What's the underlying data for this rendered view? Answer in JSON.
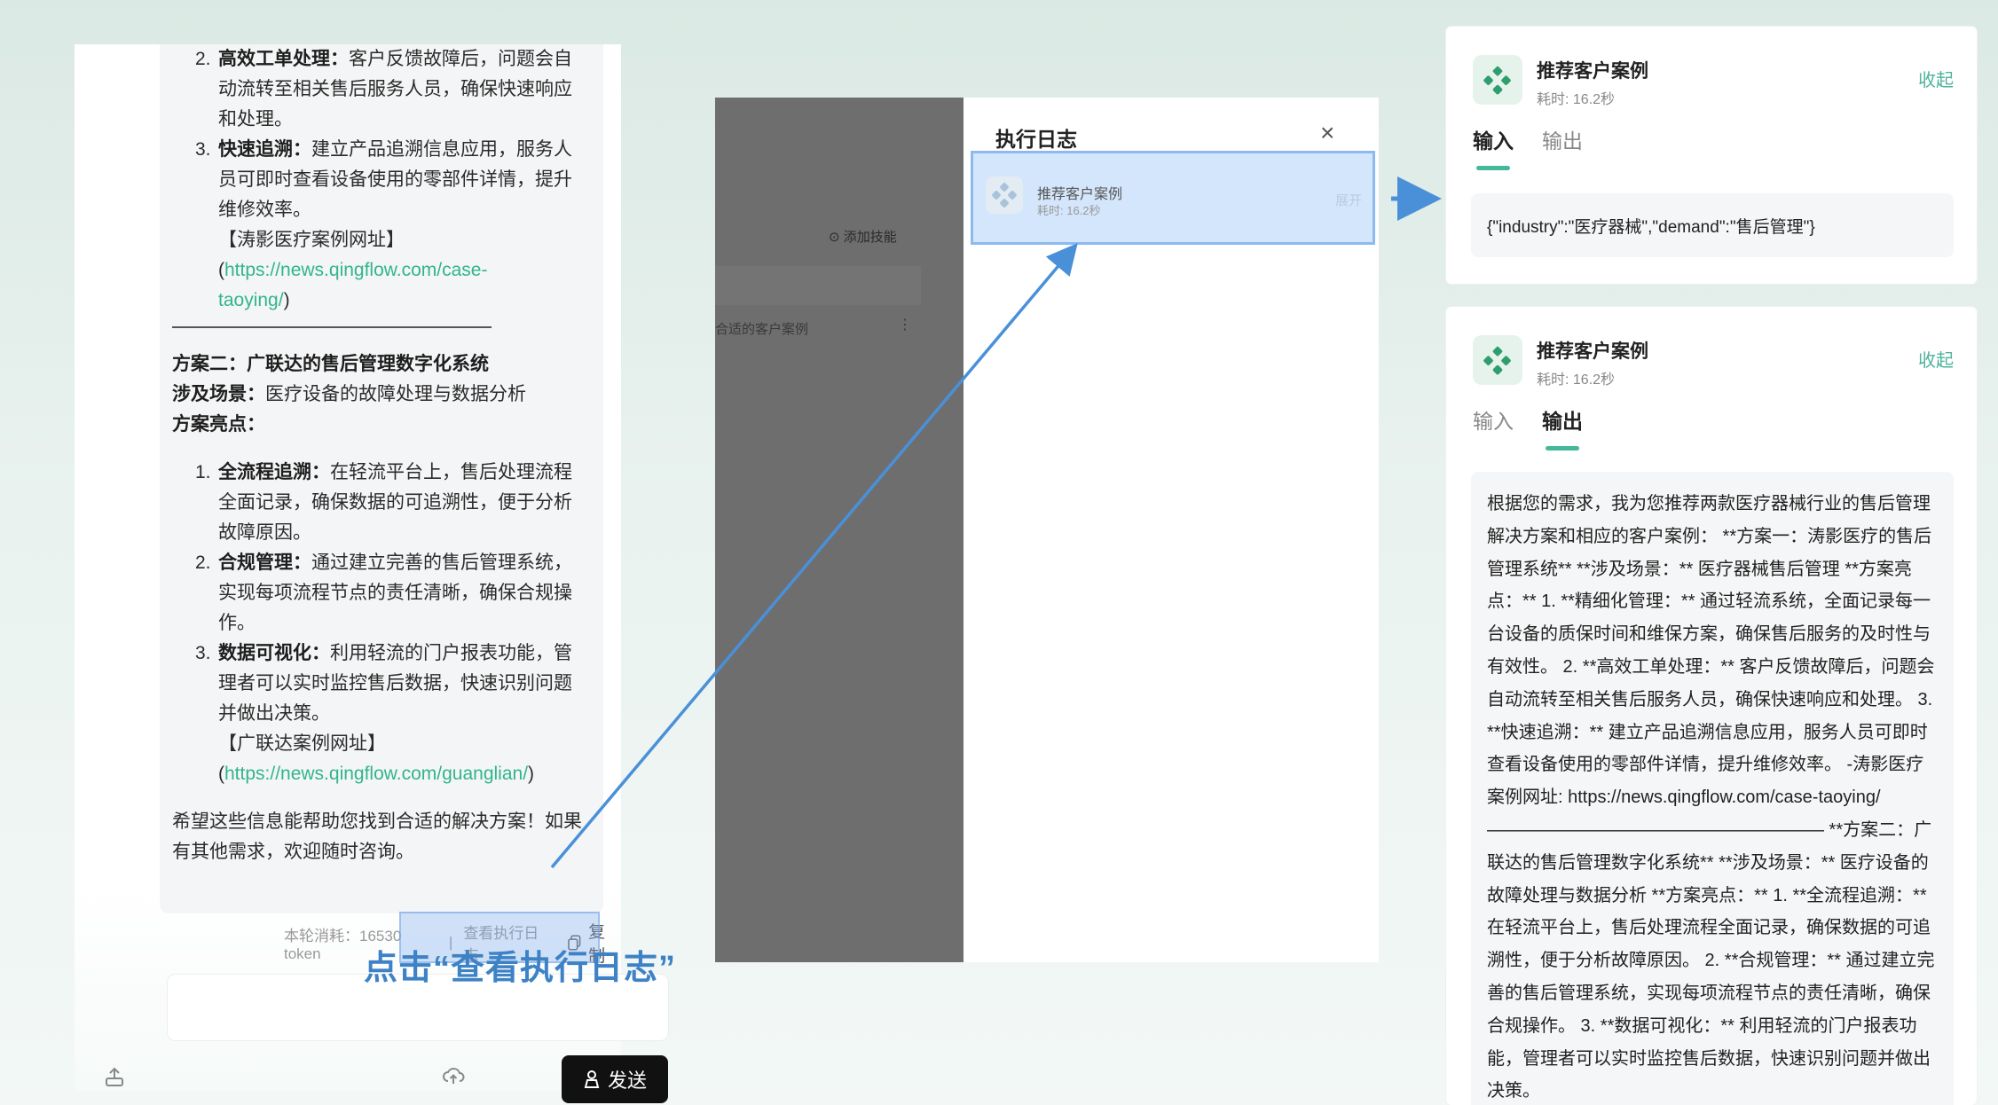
{
  "chat": {
    "item2_title": "高效工单处理：",
    "item2_text": "客户反馈故障后，问题会自动流转至相关售后服务人员，确保快速响应和处理。",
    "item3_title": "快速追溯：",
    "item3_text": "建立产品追溯信息应用，服务人员可即时查看设备使用的零部件详情，提升维修效率。",
    "case1_label": "【涛影医疗案例网址】",
    "case1_url_l1": "https://news.qingflow.com/case-",
    "case1_url_l2": "taoying/",
    "paren_open": "(",
    "paren_close": ")",
    "plan2_title": "方案二：广联达的售后管理数字化系统",
    "scene_label": "涉及场景：",
    "scene_text": "医疗设备的故障处理与数据分析",
    "highlights_label": "方案亮点：",
    "p1_title": "全流程追溯：",
    "p1_text": "在轻流平台上，售后处理流程全面记录，确保数据的可追溯性，便于分析故障原因。",
    "p2_title": "合规管理：",
    "p2_text": "通过建立完善的售后管理系统，实现每项流程节点的责任清晰，确保合规操作。",
    "p3_title": "数据可视化：",
    "p3_text": "利用轻流的门户报表功能，管理者可以实时监控售后数据，快速识别问题并做出决策。",
    "case2_label": "【广联达案例网址】",
    "case2_url": "https://news.qingflow.com/guanglian/",
    "closing": "希望这些信息能帮助您找到合适的解决方案！如果有其他需求，欢迎随时咨询。",
    "footer_tokens": "本轮消耗：16530 token",
    "footer_divider": "|",
    "footer_view_log": "查看执行日志",
    "footer_copy": "复制",
    "callout": "点击“查看执行日志”",
    "send_label": "发送",
    "nums": [
      "2.",
      "3.",
      "1.",
      "2.",
      "3."
    ]
  },
  "dark_panel": {
    "add_skill": "添加技能",
    "case_label": "合适的客户案例",
    "dots": "⋮"
  },
  "log": {
    "title": "执行日志",
    "close": "×",
    "item_name": "推荐客户案例",
    "item_time": "耗时: 16.2秒",
    "item_expand": "展开"
  },
  "card_input": {
    "title": "推荐客户案例",
    "time": "耗时: 16.2秒",
    "collapse": "收起",
    "tab_input": "输入",
    "tab_output": "输出",
    "json": "{\"industry\":\"医疗器械\",\"demand\":\"售后管理\"}"
  },
  "card_output": {
    "title": "推荐客户案例",
    "time": "耗时: 16.2秒",
    "collapse": "收起",
    "tab_input": "输入",
    "tab_output": "输出",
    "text": "根据您的需求，我为您推荐两款医疗器械行业的售后管理解决方案和相应的客户案例： **方案一：涛影医疗的售后管理系统** **涉及场景：** 医疗器械售后管理 **方案亮点：** 1. **精细化管理：** 通过轻流系统，全面记录每一台设备的质保时间和维保方案，确保售后服务的及时性与有效性。 2. **高效工单处理：** 客户反馈故障后，问题会自动流转至相关售后服务人员，确保快速响应和处理。 3. **快速追溯：** 建立产品追溯信息应用，服务人员可即时查看设备使用的零部件详情，提升维修效率。 -涛影医疗案例网址: https://news.qingflow.com/case-taoying/ ——————————————————— **方案二：广联达的售后管理数字化系统** **涉及场景：** 医疗设备的故障处理与数据分析 **方案亮点：** 1. **全流程追溯：** 在轻流平台上，售后处理流程全面记录，确保数据的可追溯性，便于分析故障原因。 2. **合规管理：** 通过建立完善的售后管理系统，实现每项流程节点的责任清晰，确保合规操作。 3. **数据可视化：** 利用轻流的门户报表功能，管理者可以实时监控售后数据，快速识别问题并做出决策。"
  },
  "colors": {
    "accent_green": "#31b58c",
    "callout_blue": "#3e82c6",
    "arrow_blue": "#4a90d9",
    "highlight_blue": "#d4e6fb"
  },
  "icons": {
    "upload": "upload-icon",
    "cloud": "cloud-upload-icon",
    "send": "send-person-icon",
    "copy": "copy-icon",
    "logo": "skill-logo-icon",
    "close": "close-icon"
  }
}
